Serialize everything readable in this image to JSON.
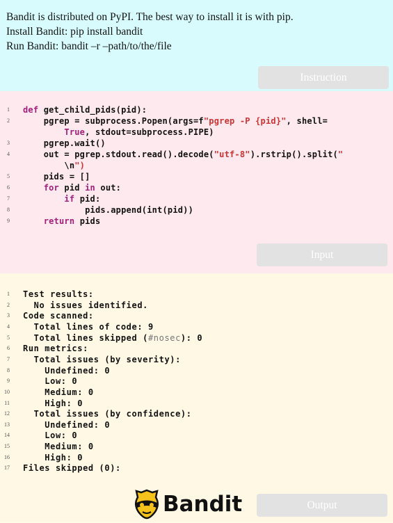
{
  "instruction": {
    "lines": [
      "Bandit is distributed on PyPI. The best way to install it is with pip.",
      "Install Bandit: pip install bandit",
      "Run Bandit: bandit –r –path/to/the/file"
    ],
    "label": "Instruction"
  },
  "input": {
    "label": "Input",
    "code": [
      {
        "n": "1",
        "text": "def get_child_pids(pid):"
      },
      {
        "n": "2",
        "text": "    pgrep = subprocess.Popen(args=f\"pgrep -P {pid}\", shell="
      },
      {
        "n": "",
        "text": "        True, stdout=subprocess.PIPE)"
      },
      {
        "n": "3",
        "text": "    pgrep.wait()"
      },
      {
        "n": "4",
        "text": "    out = pgrep.stdout.read().decode(\"utf-8\").rstrip().split(\""
      },
      {
        "n": "",
        "text": "        \\n\")"
      },
      {
        "n": "5",
        "text": "    pids = []"
      },
      {
        "n": "6",
        "text": "    for pid in out:"
      },
      {
        "n": "7",
        "text": "        if pid:"
      },
      {
        "n": "8",
        "text": "            pids.append(int(pid))"
      },
      {
        "n": "9",
        "text": "    return pids"
      }
    ]
  },
  "output": {
    "label": "Output",
    "lines": [
      {
        "n": "1",
        "text": "Test results:"
      },
      {
        "n": "2",
        "text": "  No issues identified."
      },
      {
        "n": "3",
        "text": "Code scanned:"
      },
      {
        "n": "4",
        "text": "  Total lines of code: 9"
      },
      {
        "n": "5",
        "text": "  Total lines skipped (#nosec): 0"
      },
      {
        "n": "6",
        "text": "Run metrics:"
      },
      {
        "n": "7",
        "text": "  Total issues (by severity):"
      },
      {
        "n": "8",
        "text": "    Undefined: 0"
      },
      {
        "n": "9",
        "text": "    Low: 0"
      },
      {
        "n": "10",
        "text": "    Medium: 0"
      },
      {
        "n": "11",
        "text": "    High: 0"
      },
      {
        "n": "12",
        "text": "  Total issues (by confidence):"
      },
      {
        "n": "13",
        "text": "    Undefined: 0"
      },
      {
        "n": "14",
        "text": "    Low: 0"
      },
      {
        "n": "15",
        "text": "    Medium: 0"
      },
      {
        "n": "16",
        "text": "    High: 0"
      },
      {
        "n": "17",
        "text": "Files skipped (0):"
      }
    ]
  },
  "logo": {
    "text": "Bandit",
    "icon": "bandit-mask-icon"
  },
  "colors": {
    "instruction_bg": "#d8fcfd",
    "input_bg": "#fde9ee",
    "output_bg": "#fef8e5",
    "keyword": "#a2207a",
    "string": "#cc3333",
    "logo_yellow": "#f6c21c"
  }
}
